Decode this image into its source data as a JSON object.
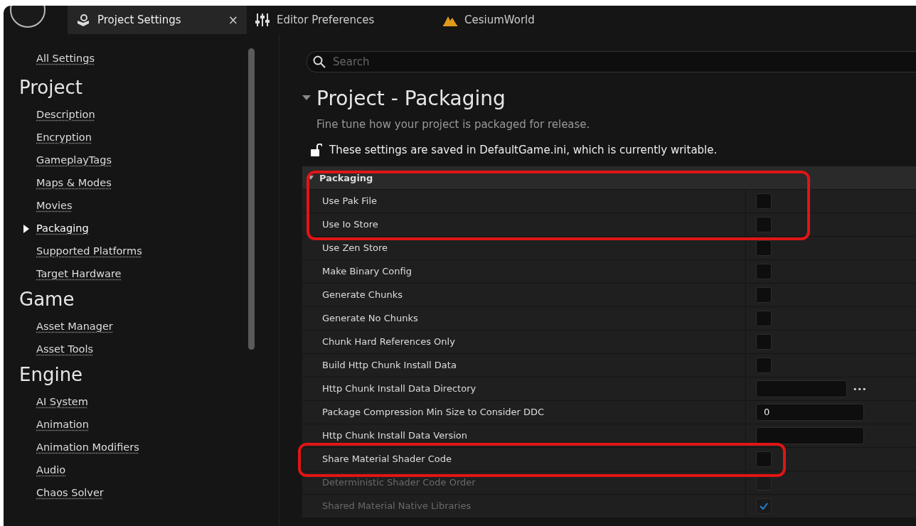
{
  "tabs": [
    {
      "label": "Project Settings",
      "kind": "settings",
      "selected": true,
      "closable": true
    },
    {
      "label": "Editor Preferences",
      "kind": "sliders",
      "selected": false,
      "closable": false
    },
    {
      "label": "CesiumWorld",
      "kind": "level",
      "selected": false,
      "closable": false
    }
  ],
  "close_glyph": "×",
  "sidebar": {
    "all_settings": "All Settings",
    "sections": [
      {
        "heading": "Project",
        "items": [
          {
            "label": "Description",
            "selected": false
          },
          {
            "label": "Encryption",
            "selected": false
          },
          {
            "label": "GameplayTags",
            "selected": false
          },
          {
            "label": "Maps & Modes",
            "selected": false
          },
          {
            "label": "Movies",
            "selected": false
          },
          {
            "label": "Packaging",
            "selected": true
          },
          {
            "label": "Supported Platforms",
            "selected": false
          },
          {
            "label": "Target Hardware",
            "selected": false
          }
        ]
      },
      {
        "heading": "Game",
        "items": [
          {
            "label": "Asset Manager",
            "selected": false
          },
          {
            "label": "Asset Tools",
            "selected": false
          }
        ]
      },
      {
        "heading": "Engine",
        "items": [
          {
            "label": "AI System",
            "selected": false
          },
          {
            "label": "Animation",
            "selected": false
          },
          {
            "label": "Animation Modifiers",
            "selected": false
          },
          {
            "label": "Audio",
            "selected": false
          },
          {
            "label": "Chaos Solver",
            "selected": false
          }
        ]
      }
    ]
  },
  "search": {
    "placeholder": "Search"
  },
  "page": {
    "title": "Project - Packaging",
    "description": "Fine tune how your project is packaged for release.",
    "save_note": "These settings are saved in DefaultGame.ini, which is currently writable."
  },
  "category": {
    "title": "Packaging",
    "expanded": true
  },
  "rows": [
    {
      "label": "Use Pak File",
      "kind": "checkbox",
      "checked": false,
      "disabled": false
    },
    {
      "label": "Use Io Store",
      "kind": "checkbox",
      "checked": false,
      "disabled": false
    },
    {
      "label": "Use Zen Store",
      "kind": "checkbox",
      "checked": false,
      "disabled": false
    },
    {
      "label": "Make Binary Config",
      "kind": "checkbox",
      "checked": false,
      "disabled": false
    },
    {
      "label": "Generate Chunks",
      "kind": "checkbox",
      "checked": false,
      "disabled": false
    },
    {
      "label": "Generate No Chunks",
      "kind": "checkbox",
      "checked": false,
      "disabled": false
    },
    {
      "label": "Chunk Hard References Only",
      "kind": "checkbox",
      "checked": false,
      "disabled": false
    },
    {
      "label": "Build Http Chunk Install Data",
      "kind": "checkbox",
      "checked": false,
      "disabled": false
    },
    {
      "label": "Http Chunk Install Data Directory",
      "kind": "path",
      "value": "",
      "disabled": false,
      "browse": "•••"
    },
    {
      "label": "Package Compression Min Size to Consider DDC",
      "kind": "number",
      "value": "0",
      "disabled": false
    },
    {
      "label": "Http Chunk Install Data Version",
      "kind": "text",
      "value": "",
      "disabled": false
    },
    {
      "label": "Share Material Shader Code",
      "kind": "checkbox",
      "checked": false,
      "disabled": false
    },
    {
      "label": "Deterministic Shader Code Order",
      "kind": "checkbox",
      "checked": false,
      "disabled": true
    },
    {
      "label": "Shared Material Native Libraries",
      "kind": "checkbox",
      "checked": true,
      "disabled": true
    }
  ]
}
